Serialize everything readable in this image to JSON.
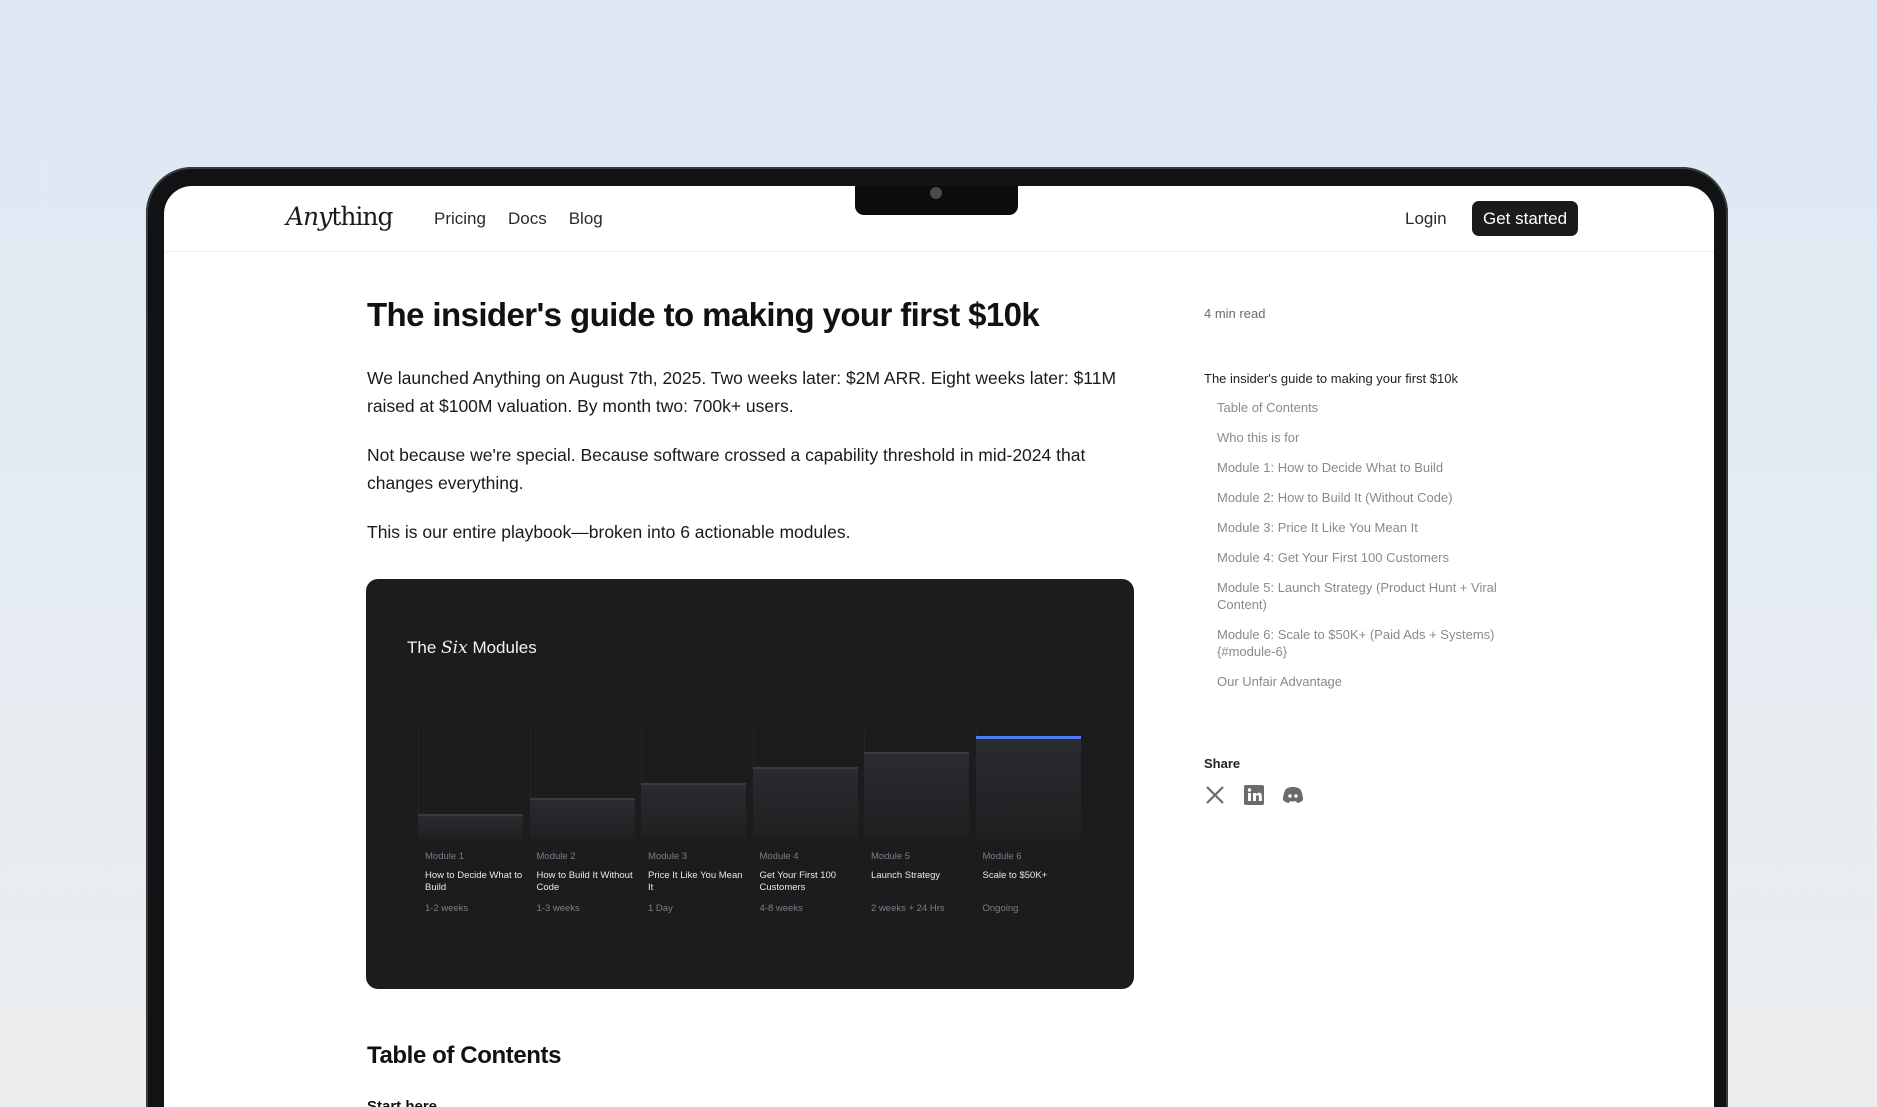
{
  "nav": {
    "logo_italic": "Any",
    "logo_rest": "thing",
    "links": [
      "Pricing",
      "Docs",
      "Blog"
    ],
    "login": "Login",
    "cta": "Get started"
  },
  "article": {
    "title": "The insider's guide to making your first $10k",
    "paragraphs": [
      "We launched Anything on August 7th, 2025. Two weeks later: $2M ARR. Eight weeks later: $11M raised at $100M valuation. By month two: 700k+ users.",
      "Not because we're special. Because software crossed a capability threshold in mid-2024 that changes everything.",
      "This is our entire playbook—broken into 6 actionable modules."
    ],
    "card": {
      "title_pre": "The",
      "title_em": "Six",
      "title_post": "Modules",
      "modules": [
        {
          "num": "Module 1",
          "name": "How to Decide What to Build",
          "dur": "1-2 weeks",
          "level": 1
        },
        {
          "num": "Module 2",
          "name": "How to Build It Without Code",
          "dur": "1-3 weeks",
          "level": 2
        },
        {
          "num": "Module 3",
          "name": "Price It Like You Mean It",
          "dur": "1 Day",
          "level": 3
        },
        {
          "num": "Module 4",
          "name": "Get Your First 100 Customers",
          "dur": "4-8 weeks",
          "level": 4
        },
        {
          "num": "Module 5",
          "name": "Launch Strategy",
          "dur": "2 weeks + 24 Hrs",
          "level": 5
        },
        {
          "num": "Module 6",
          "name": "Scale to $50K+",
          "dur": "Ongoing",
          "level": 6
        }
      ]
    },
    "toc_heading": "Table of Contents",
    "cut_text": "Start here"
  },
  "sidebar": {
    "read_time": "4 min read",
    "toc_main": "The insider's guide to making your first $10k",
    "toc_items": [
      "Table of Contents",
      "Who this is for",
      "Module 1: How to Decide What to Build",
      "Module 2: How to Build It (Without Code)",
      "Module 3: Price It Like You Mean It",
      "Module 4: Get Your First 100 Customers",
      "Module 5: Launch Strategy (Product Hunt + Viral Content)",
      "Module 6: Scale to $50K+ (Paid Ads + Systems) {#module-6}",
      "Our Unfair Advantage"
    ],
    "share_label": "Share",
    "share_icons": [
      "x-icon",
      "linkedin-icon",
      "discord-icon"
    ]
  },
  "colors": {
    "accent": "#4d7cf0",
    "card_bg": "#1b1c1e",
    "cta_bg": "#1b1b1c"
  }
}
